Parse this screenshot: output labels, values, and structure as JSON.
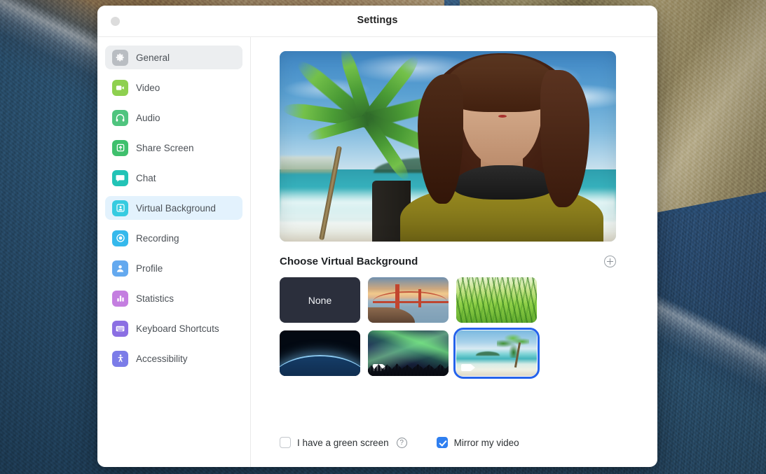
{
  "window": {
    "title": "Settings",
    "close_control": "close-window-control"
  },
  "sidebar": {
    "items": [
      {
        "label": "General",
        "icon": "gear-icon",
        "color": "#b9bdc2",
        "state": "hover"
      },
      {
        "label": "Video",
        "icon": "video-camera-icon",
        "color": "#8ed04f",
        "state": "normal"
      },
      {
        "label": "Audio",
        "icon": "headphones-icon",
        "color": "#4fc47e",
        "state": "normal"
      },
      {
        "label": "Share Screen",
        "icon": "share-screen-icon",
        "color": "#3fc06d",
        "state": "normal"
      },
      {
        "label": "Chat",
        "icon": "chat-bubble-icon",
        "color": "#22c3b6",
        "state": "normal"
      },
      {
        "label": "Virtual Background",
        "icon": "virtual-background-icon",
        "color": "#37cbe0",
        "state": "selected"
      },
      {
        "label": "Recording",
        "icon": "record-circle-icon",
        "color": "#35b9ec",
        "state": "normal"
      },
      {
        "label": "Profile",
        "icon": "person-icon",
        "color": "#64a9ef",
        "state": "normal"
      },
      {
        "label": "Statistics",
        "icon": "bar-chart-icon",
        "color": "#c47ee0",
        "state": "normal"
      },
      {
        "label": "Keyboard Shortcuts",
        "icon": "keyboard-icon",
        "color": "#8b6fe3",
        "state": "normal"
      },
      {
        "label": "Accessibility",
        "icon": "accessibility-icon",
        "color": "#7b7ce8",
        "state": "normal"
      }
    ]
  },
  "main": {
    "preview": {
      "name": "video-preview",
      "description": "Woman with headphones in front of tropical beach virtual background"
    },
    "section_title": "Choose Virtual Background",
    "add_button": "add-background-button",
    "backgrounds": [
      {
        "name": "None",
        "kind": "none",
        "selected": false,
        "is_video": false
      },
      {
        "name": "Golden Gate",
        "kind": "bridge",
        "selected": false,
        "is_video": false
      },
      {
        "name": "Grass",
        "kind": "grass",
        "selected": false,
        "is_video": false
      },
      {
        "name": "Earth",
        "kind": "earth",
        "selected": false,
        "is_video": false
      },
      {
        "name": "Aurora",
        "kind": "aurora",
        "selected": false,
        "is_video": true
      },
      {
        "name": "Beach",
        "kind": "beach",
        "selected": true,
        "is_video": true
      }
    ],
    "options": {
      "green_screen": {
        "label": "I have a green screen",
        "checked": false,
        "help": "?"
      },
      "mirror_video": {
        "label": "Mirror my video",
        "checked": true
      }
    }
  },
  "colors": {
    "accent_blue": "#2f7ff0",
    "selection_outline": "#2563eb",
    "sidebar_selected_bg": "#e3f2fd",
    "sidebar_hover_bg": "#eceef0"
  }
}
